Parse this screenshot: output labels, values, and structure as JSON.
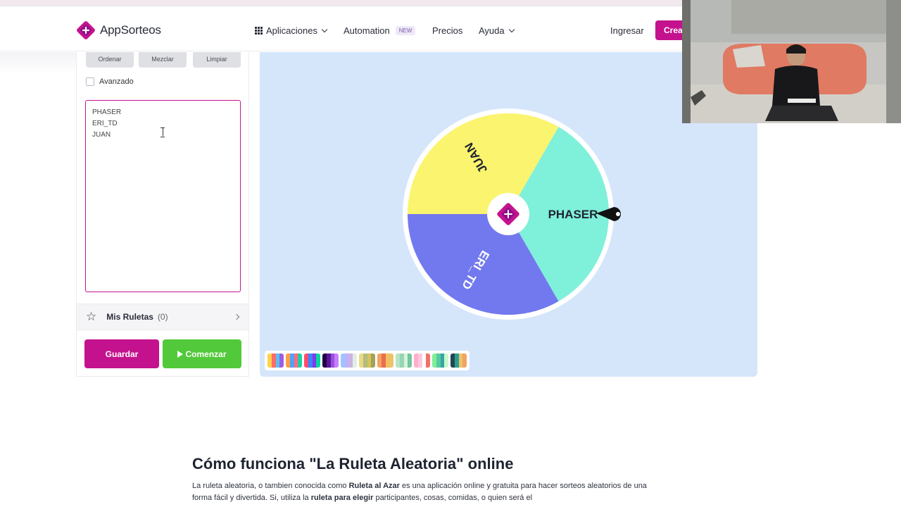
{
  "brand": {
    "name": "AppSorteos",
    "color_primary": "#c4128e",
    "color_success": "#52c93a"
  },
  "nav": {
    "aplicaciones": "Aplicaciones",
    "automation": "Automation",
    "new_badge": "NEW",
    "precios": "Precios",
    "ayuda": "Ayuda",
    "ingresar": "Ingresar",
    "crear": "Crea"
  },
  "panel": {
    "tools": [
      "Ordenar",
      "Mezclar",
      "Limpiar"
    ],
    "advanced_label": "Avanzado",
    "entries": [
      "PHASER",
      "ERI_TD",
      "JUAN"
    ],
    "mis_ruletas_label": "Mis Ruletas",
    "mis_ruletas_count": "(0)",
    "guardar": "Guardar",
    "comenzar": "Comenzar"
  },
  "wheel": {
    "segments": [
      {
        "label": "PHASER",
        "color": "#7ff0da"
      },
      {
        "label": "ERI_TD",
        "color": "#7279ee"
      },
      {
        "label": "JUAN",
        "color": "#fbf46e"
      }
    ],
    "icons": {
      "center": "appsorteos-logo-icon",
      "pointer": "pointer-icon"
    }
  },
  "palettes": [
    [
      "#ffd24a",
      "#ff6b6b",
      "#5bc0eb",
      "#9b5de5"
    ],
    [
      "#ff9f43",
      "#54a0ff",
      "#ff6b81",
      "#1dd1a1"
    ],
    [
      "#ff4d6d",
      "#3a86ff",
      "#8338ec",
      "#06d6a0"
    ],
    [
      "#240046",
      "#5a189a",
      "#9d4edd",
      "#c77dff"
    ],
    [
      "#a0c4ff",
      "#bdb2ff",
      "#cdb4db",
      "#e2ece9"
    ],
    [
      "#e9d985",
      "#b2bd7e",
      "#d6c35b",
      "#a3a05c"
    ],
    [
      "#f4a261",
      "#e76f51",
      "#f6bd60",
      "#e9c46a"
    ],
    [
      "#b7e4c7",
      "#95d5b2",
      "#d8f3dc",
      "#74c69d"
    ],
    [
      "#ffafcc",
      "#ffc8dd",
      "#ffffff",
      "#f07167"
    ],
    [
      "#80ed99",
      "#57cc99",
      "#38a3a5",
      "#c7f9cc"
    ],
    [
      "#264653",
      "#2a9d8f",
      "#e9c46a",
      "#f4a261"
    ]
  ],
  "article": {
    "title": "Cómo funciona \"La Ruleta Aleatoria\" online",
    "p1_a": "La ruleta aleatoria, o tambien conocida como ",
    "p1_b": "Ruleta al Azar",
    "p1_c": " es una aplicación online y gratuita para hacer sorteos aleatorios de una forma fácil y divertida. Si, utiliza la ",
    "p1_d": "ruleta para elegir",
    "p1_e": " participantes, cosas, comidas, o quien será el"
  }
}
